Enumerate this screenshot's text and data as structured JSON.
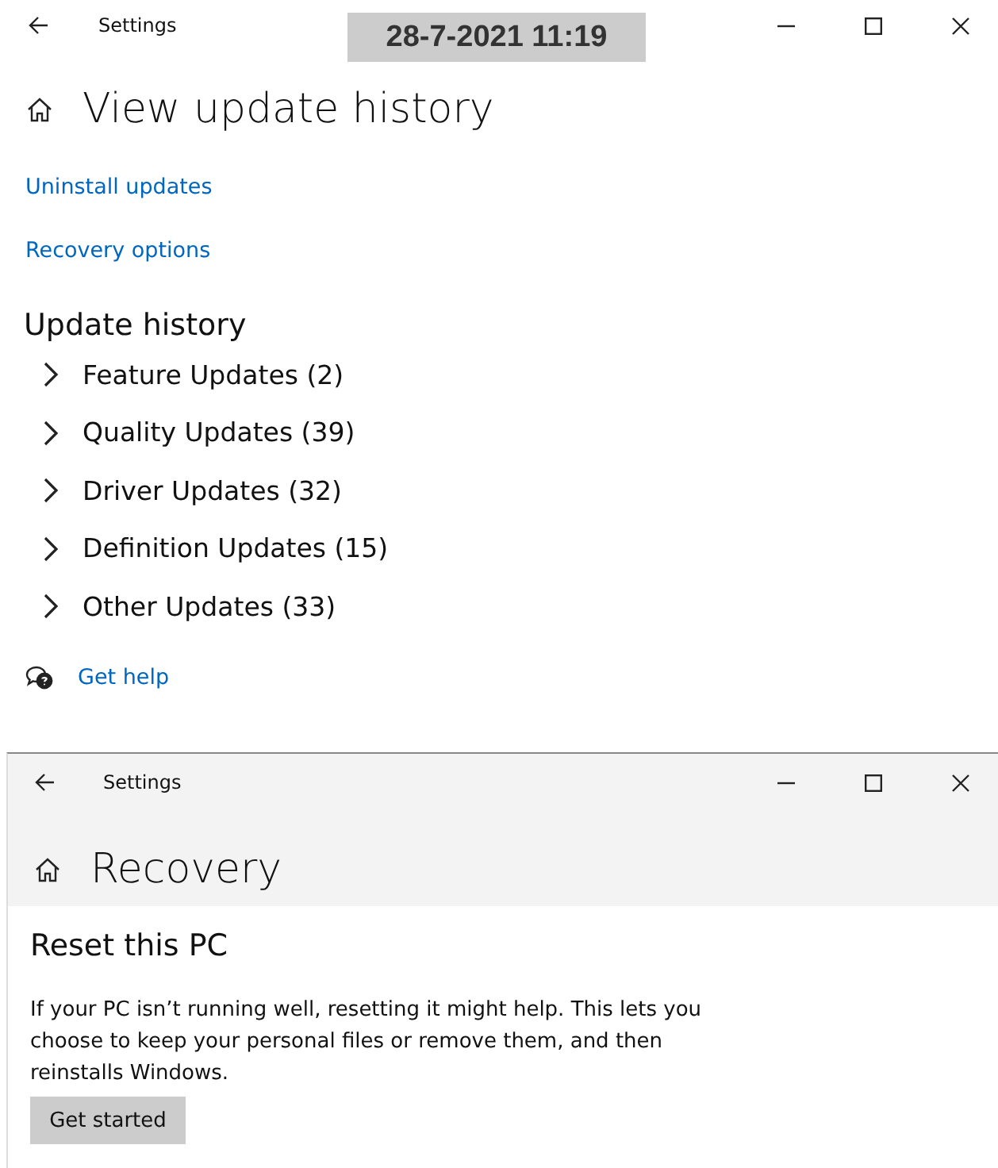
{
  "timestamp": "28-7-2021 11:19",
  "window": {
    "title": "Settings",
    "heading": "View update history",
    "links": [
      "Uninstall updates",
      "Recovery options"
    ],
    "section_title": "Update history",
    "groups": [
      {
        "label": "Feature Updates (2)",
        "expanded": false
      },
      {
        "label": "Quality Updates (39)",
        "expanded": false
      },
      {
        "label": "Driver Updates (32)",
        "expanded": false
      },
      {
        "label": "Definition Updates (15)",
        "expanded": false
      },
      {
        "label": "Other Updates (33)",
        "expanded": false
      }
    ],
    "help_link": "Get help"
  },
  "second_window": {
    "title": "Settings",
    "heading": "Recovery",
    "section_title": "Reset this PC",
    "description": "If your PC isn’t running well, resetting it might help. This lets you choose to keep your personal files or remove them, and then reinstalls Windows.",
    "button": "Get started"
  }
}
